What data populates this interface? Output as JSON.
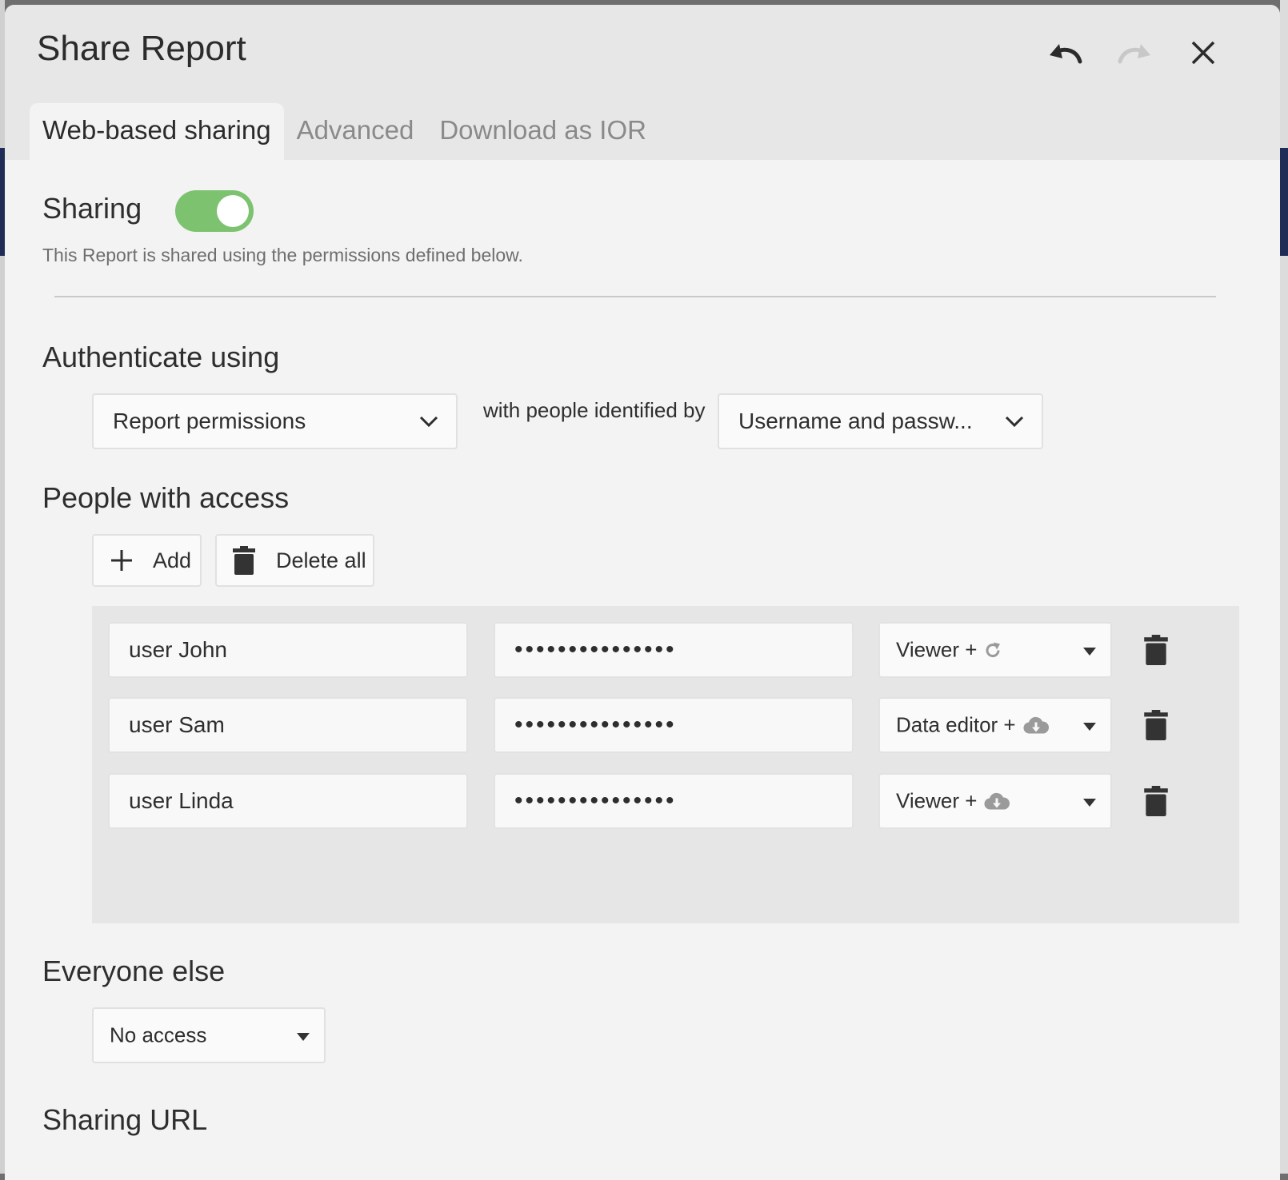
{
  "dialog": {
    "title": "Share Report",
    "icons": {
      "undo": "undo-icon",
      "redo": "redo-icon",
      "close": "close-icon"
    }
  },
  "tabs": [
    {
      "label": "Web-based sharing",
      "active": true
    },
    {
      "label": "Advanced",
      "active": false
    },
    {
      "label": "Download as IOR",
      "active": false
    }
  ],
  "sharing": {
    "label": "Sharing",
    "enabled": true,
    "description": "This Report is shared using the permissions defined below.",
    "toggle_color": "#7cc26f"
  },
  "authenticate": {
    "label": "Authenticate using",
    "method": "Report permissions",
    "identified_by_text": "with people identified by",
    "identity": "Username and passw..."
  },
  "people": {
    "label": "People with access",
    "add_label": "Add",
    "delete_all_label": "Delete all",
    "rows": [
      {
        "user": "user John",
        "password": "•••••••••••••••",
        "role": "Viewer +",
        "role_icon": "refresh-icon"
      },
      {
        "user": "user Sam",
        "password": "•••••••••••••••",
        "role": "Data editor +",
        "role_icon": "cloud-download-icon"
      },
      {
        "user": "user Linda",
        "password": "•••••••••••••••",
        "role": "Viewer +",
        "role_icon": "cloud-download-icon"
      }
    ]
  },
  "everyone_else": {
    "label": "Everyone else",
    "value": "No access"
  },
  "sharing_url": {
    "label": "Sharing URL"
  }
}
